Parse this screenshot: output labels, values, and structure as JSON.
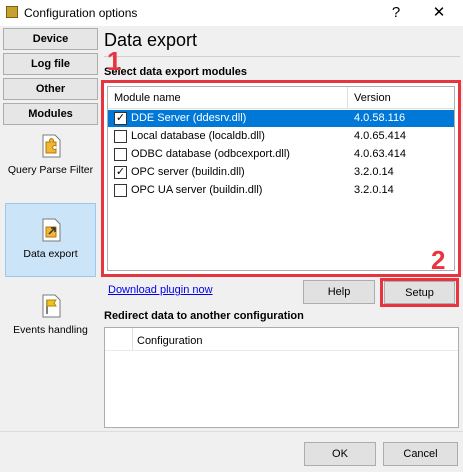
{
  "window": {
    "title": "Configuration options",
    "help_glyph": "?",
    "close_glyph": "✕"
  },
  "sidebar": {
    "buttons": [
      "Device",
      "Log file",
      "Other",
      "Modules"
    ],
    "tiles": [
      {
        "label": "Query Parse Filter",
        "icon": "puzzle-icon"
      },
      {
        "label": "Data export",
        "icon": "export-icon"
      },
      {
        "label": "Events handling",
        "icon": "flag-icon"
      }
    ]
  },
  "main": {
    "title": "Data export",
    "modules_label": "Select data export modules",
    "columns": {
      "name": "Module name",
      "version": "Version"
    },
    "modules": [
      {
        "name": "DDE Server (ddesrv.dll)",
        "version": "4.0.58.116",
        "checked": true,
        "selected": true
      },
      {
        "name": "Local database (localdb.dll)",
        "version": "4.0.65.414",
        "checked": false,
        "selected": false
      },
      {
        "name": "ODBC database (odbcexport.dll)",
        "version": "4.0.63.414",
        "checked": false,
        "selected": false
      },
      {
        "name": "OPC server (buildin.dll)",
        "version": "3.2.0.14",
        "checked": true,
        "selected": false
      },
      {
        "name": "OPC UA server (buildin.dll)",
        "version": "3.2.0.14",
        "checked": false,
        "selected": false
      }
    ],
    "badge1": "1",
    "badge2": "2",
    "download_link": "Download plugin now",
    "help_button": "Help",
    "setup_button": "Setup",
    "redirect_label": "Redirect data to another configuration",
    "config_header": "Configuration"
  },
  "footer": {
    "ok": "OK",
    "cancel": "Cancel"
  },
  "colors": {
    "highlight": "#0078d7",
    "annotation": "#e8343f",
    "link": "#0000ee"
  }
}
